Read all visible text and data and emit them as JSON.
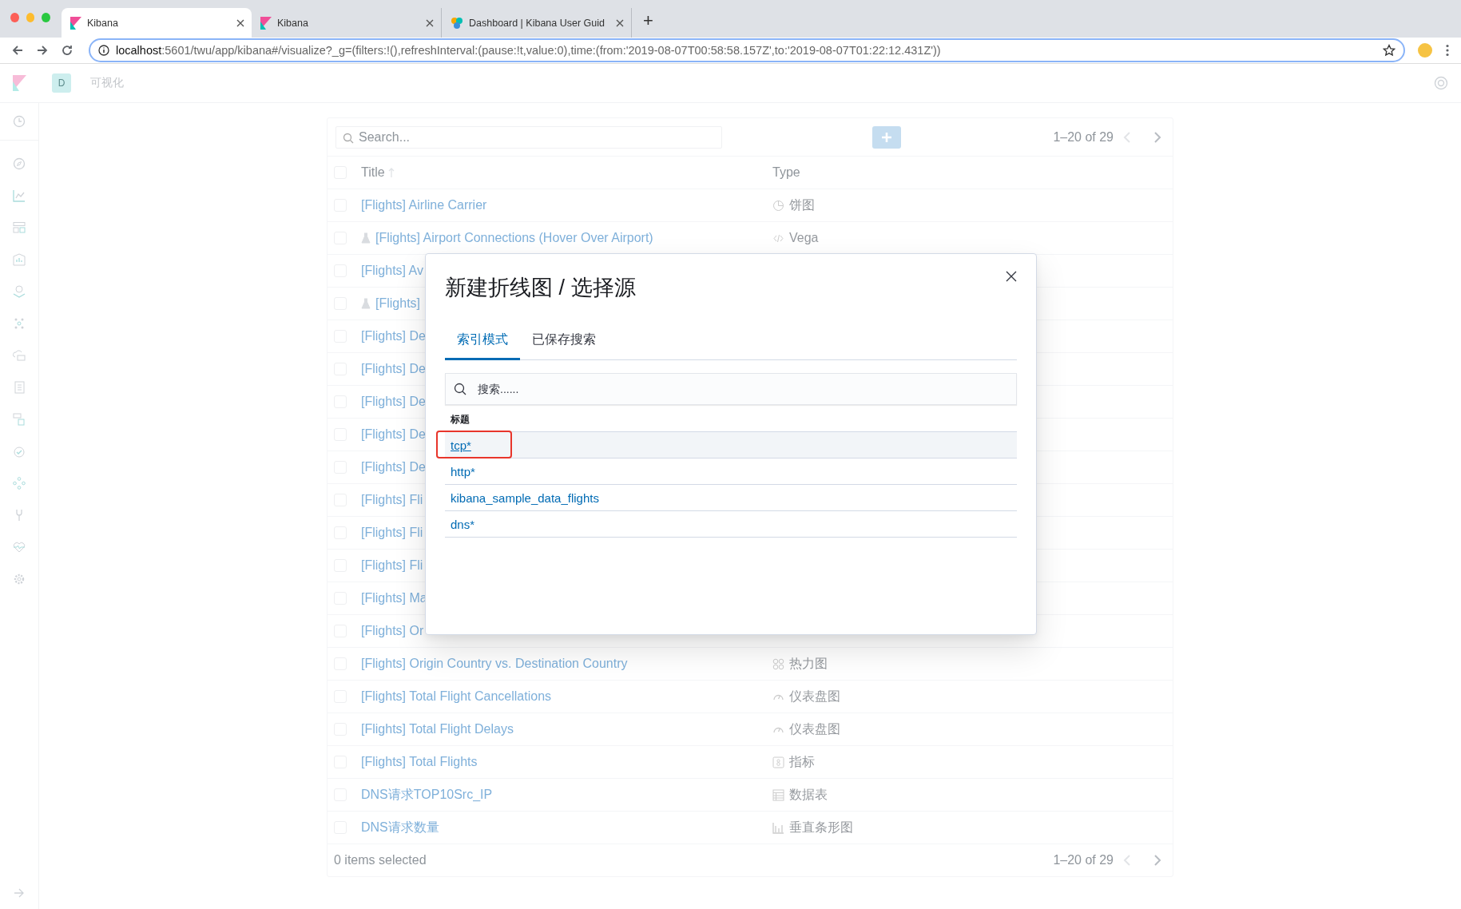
{
  "browser": {
    "tabs": [
      {
        "title": "Kibana",
        "kind": "kibana",
        "selected": true
      },
      {
        "title": "Kibana",
        "kind": "kibana",
        "selected": false
      },
      {
        "title": "Dashboard | Kibana User Guid",
        "kind": "dots",
        "selected": false
      }
    ],
    "new_tab": "+",
    "url_host": "localhost",
    "url_rest": ":5601/twu/app/kibana#/visualize?_g=(filters:!(),refreshInterval:(pause:!t,value:0),time:(from:'2019-08-07T00:58:58.157Z',to:'2019-08-07T01:22:12.431Z'))"
  },
  "header": {
    "avatar": "D",
    "breadcrumb": "可视化"
  },
  "list": {
    "search_placeholder": "Search...",
    "all_checked": false,
    "pagination": "1–20 of 29",
    "columns": [
      "Title",
      "Type"
    ],
    "rows": [
      {
        "title": "[Flights] Airline Carrier",
        "checked": false,
        "experimental": false,
        "kind": "pie",
        "type": "饼图"
      },
      {
        "title": "[Flights] Airport Connections (Hover Over Airport)",
        "checked": false,
        "experimental": true,
        "kind": "code",
        "type": "Vega"
      },
      {
        "title": "[Flights] Av",
        "checked": false,
        "experimental": false
      },
      {
        "title": "[Flights]",
        "checked": false,
        "experimental": true
      },
      {
        "title": "[Flights] De",
        "checked": false,
        "experimental": false
      },
      {
        "title": "[Flights] De",
        "checked": false,
        "experimental": false
      },
      {
        "title": "[Flights] De",
        "checked": false,
        "experimental": false
      },
      {
        "title": "[Flights] De",
        "checked": false,
        "experimental": false
      },
      {
        "title": "[Flights] De",
        "checked": false,
        "experimental": false
      },
      {
        "title": "[Flights] Fli",
        "checked": false,
        "experimental": false
      },
      {
        "title": "[Flights] Fli",
        "checked": false,
        "experimental": false
      },
      {
        "title": "[Flights] Fli",
        "checked": false,
        "experimental": false
      },
      {
        "title": "[Flights] Ma",
        "checked": false,
        "experimental": false
      },
      {
        "title": "[Flights] Or",
        "checked": false,
        "experimental": false
      },
      {
        "title": "[Flights] Origin Country vs. Destination Country",
        "checked": false,
        "experimental": false,
        "kind": "heatmap",
        "type": "热力图"
      },
      {
        "title": "[Flights] Total Flight Cancellations",
        "checked": false,
        "experimental": false,
        "kind": "gauge",
        "type": "仪表盘图"
      },
      {
        "title": "[Flights] Total Flight Delays",
        "checked": false,
        "experimental": false,
        "kind": "gauge",
        "type": "仪表盘图"
      },
      {
        "title": "[Flights] Total Flights",
        "checked": false,
        "experimental": false,
        "kind": "metric",
        "type": "指标"
      },
      {
        "title": "DNS请求TOP10Src_IP",
        "checked": false,
        "experimental": false,
        "kind": "table",
        "type": "数据表"
      },
      {
        "title": "DNS请求数量",
        "checked": false,
        "experimental": false,
        "kind": "bar",
        "type": "垂直条形图"
      }
    ],
    "footer_status": "0 items selected",
    "footer_pagination": "1–20 of 29"
  },
  "modal": {
    "title": "新建折线图 / 选择源",
    "tabs": [
      {
        "label": "索引模式",
        "selected": true
      },
      {
        "label": "已保存搜索",
        "selected": false
      }
    ],
    "search_placeholder": "搜索......",
    "column": "标题",
    "items": [
      {
        "label": "tcp*",
        "highlighted": true,
        "annotated": true
      },
      {
        "label": "http*",
        "highlighted": false,
        "annotated": false
      },
      {
        "label": "kibana_sample_data_flights",
        "highlighted": false,
        "annotated": false
      },
      {
        "label": "dns*",
        "highlighted": false,
        "annotated": false
      }
    ]
  }
}
